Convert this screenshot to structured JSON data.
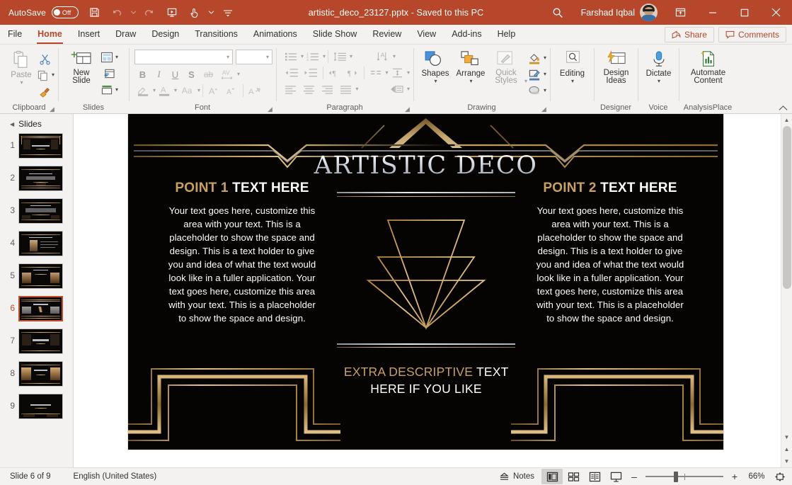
{
  "titlebar": {
    "autosave_label": "AutoSave",
    "autosave_state": "Off",
    "document_title": "artistic_deco_23127.pptx  -  Saved to this PC",
    "account_name": "Farshad Iqbal",
    "quick_access": [
      "save-icon",
      "undo-icon",
      "redo-icon",
      "start-from-beginning-icon",
      "touch-mode-icon",
      "customize-quick-access-icon"
    ],
    "window_controls": [
      "ribbon-display-options",
      "minimize",
      "maximize",
      "close"
    ]
  },
  "tabs": [
    {
      "label": "File",
      "active": false
    },
    {
      "label": "Home",
      "active": true
    },
    {
      "label": "Insert",
      "active": false
    },
    {
      "label": "Draw",
      "active": false
    },
    {
      "label": "Design",
      "active": false
    },
    {
      "label": "Transitions",
      "active": false
    },
    {
      "label": "Animations",
      "active": false
    },
    {
      "label": "Slide Show",
      "active": false
    },
    {
      "label": "Review",
      "active": false
    },
    {
      "label": "View",
      "active": false
    },
    {
      "label": "Add-ins",
      "active": false
    },
    {
      "label": "Help",
      "active": false
    }
  ],
  "tabs_right": {
    "share_label": "Share",
    "comments_label": "Comments"
  },
  "ribbon": {
    "groups": [
      {
        "name": "Clipboard",
        "label": "Clipboard"
      },
      {
        "name": "Slides",
        "label": "Slides"
      },
      {
        "name": "Font",
        "label": "Font"
      },
      {
        "name": "Paragraph",
        "label": "Paragraph"
      },
      {
        "name": "Drawing",
        "label": "Drawing"
      },
      {
        "name": "Editing",
        "label": ""
      },
      {
        "name": "Designer",
        "label": "Designer"
      },
      {
        "name": "Voice",
        "label": "Voice"
      },
      {
        "name": "AnalysisPlace",
        "label": "AnalysisPlace"
      }
    ],
    "clipboard": {
      "paste_label": "Paste",
      "cut_tooltip": "Cut",
      "copy_tooltip": "Copy",
      "format_painter_tooltip": "Format Painter"
    },
    "slides": {
      "new_slide_label": "New Slide",
      "layout_tooltip": "Layout",
      "reset_tooltip": "Reset",
      "section_tooltip": "Section"
    },
    "font": {
      "font_name_value": "",
      "font_size_value": "",
      "bold": "B",
      "italic": "I",
      "underline": "U",
      "shadow": "S",
      "strikethrough": "ab",
      "character_spacing": "AV",
      "text_highlight_tooltip": "Text Highlight Color",
      "font_color": "A",
      "change_case": "Aa",
      "increase_size": "A",
      "decrease_size": "A",
      "clear_formatting_tooltip": "Clear All Formatting"
    },
    "paragraph": {
      "bullets_tooltip": "Bullets",
      "numbering_tooltip": "Numbering",
      "line_spacing_tooltip": "Line Spacing",
      "text_direction_tooltip": "Text Direction",
      "decrease_indent_tooltip": "Decrease List Level",
      "increase_indent_tooltip": "Increase List Level",
      "align_text_tooltip": "Align Text",
      "convert_smartart_tooltip": "Convert to SmartArt",
      "columns_tooltip": "Add or Remove Columns"
    },
    "drawing": {
      "shapes_label": "Shapes",
      "arrange_label": "Arrange",
      "quick_styles_label": "Quick Styles",
      "shape_fill_tooltip": "Shape Fill",
      "shape_outline_tooltip": "Shape Outline",
      "shape_effects_tooltip": "Shape Effects"
    },
    "editing": {
      "label": "Editing"
    },
    "designer": {
      "label": "Design Ideas"
    },
    "voice": {
      "label": "Dictate"
    },
    "analysisplace": {
      "label": "Automate Content"
    }
  },
  "slide_pane": {
    "header": "Slides",
    "thumbnails": [
      {
        "number": "1",
        "selected": false,
        "kind": "title"
      },
      {
        "number": "2",
        "selected": false,
        "kind": "lines"
      },
      {
        "number": "3",
        "selected": false,
        "kind": "lines"
      },
      {
        "number": "4",
        "selected": false,
        "kind": "photo-left"
      },
      {
        "number": "5",
        "selected": false,
        "kind": "two-photo"
      },
      {
        "number": "6",
        "selected": true,
        "kind": "two-col"
      },
      {
        "number": "7",
        "selected": false,
        "kind": "title"
      },
      {
        "number": "8",
        "selected": false,
        "kind": "two-photo"
      },
      {
        "number": "9",
        "selected": false,
        "kind": "title"
      }
    ]
  },
  "slide": {
    "title": "ARTISTIC DECO",
    "left_point": {
      "heading_gold": "POINT 1",
      "heading_white": "TEXT HERE",
      "body": "Your text goes here, customize this area with your text. This is a placeholder to show the space and design. This is a text holder to give you and idea of what the text would look like in a fuller application. Your text goes here, customize this area with your text. This is a placeholder to show the space and design."
    },
    "right_point": {
      "heading_gold": "POINT 2",
      "heading_white": "TEXT HERE",
      "body": "Your text goes here, customize this area with your text. This is a placeholder to show the space and design. This is a text holder to give you and idea of what the text would look like in a fuller application. Your text goes here, customize this area with your text. This is a placeholder to show the space and design."
    },
    "extra_caption": {
      "gold": "EXTRA DESCRIPTIVE",
      "white_line1": "TEXT",
      "white_line2": "HERE IF YOU LIKE"
    },
    "colors": {
      "background": "#050403",
      "gold": "#c9a063",
      "silver": "#ccd1dc",
      "white": "#ffffff"
    }
  },
  "statusbar": {
    "slide_counter": "Slide 6 of 9",
    "language": "English (United States)",
    "notes_label": "Notes",
    "views": [
      {
        "name": "normal-view",
        "active": true
      },
      {
        "name": "slide-sorter-view",
        "active": false
      },
      {
        "name": "reading-view",
        "active": false
      },
      {
        "name": "slide-show-view",
        "active": false
      }
    ],
    "zoom_value": "66%",
    "zoom_out": "–",
    "zoom_in": "+"
  },
  "theme": {
    "accent": "#b7472a",
    "ribbon_bg": "#f3f2f1"
  }
}
